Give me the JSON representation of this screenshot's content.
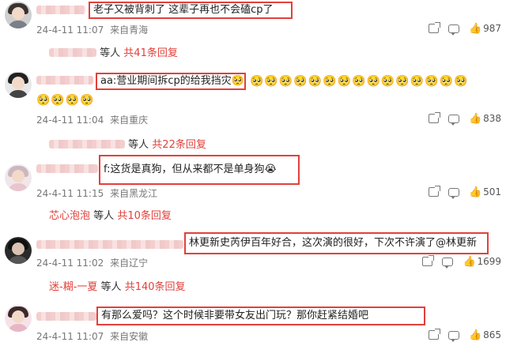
{
  "comments": [
    {
      "text": "老子又被背刺了 这辈子再也不会磕cp了",
      "date": "24-4-11 11:07",
      "location": "来自青海",
      "likes": "987",
      "reply_name": "",
      "reply_suffix": "等人",
      "reply_link": "共41条回复",
      "emojis": ""
    },
    {
      "text": "aa:营业期间拆cp的给我挡灾🥺",
      "date": "24-4-11 11:04",
      "location": "来自重庆",
      "likes": "838",
      "reply_name": "",
      "reply_suffix": "等人",
      "reply_link": "共22条回复",
      "emojis": "🥺🥺🥺🥺🥺🥺🥺🥺🥺🥺🥺🥺🥺🥺🥺",
      "emojis2": "🥺🥺🥺🥺"
    },
    {
      "text": "f:这货是真狗，但从来都不是单身狗😭",
      "date": "24-4-11 11:15",
      "location": "来自黑龙江",
      "likes": "501",
      "reply_name": "芯心泡泡",
      "reply_suffix": "等人",
      "reply_link": "共10条回复"
    },
    {
      "text": "林更新史芮伊百年好合，这次演的很好，下次不许演了@林更新",
      "date": "24-4-11 11:02",
      "location": "来自辽宁",
      "likes": "1699",
      "reply_name": "迷-糊-一夏",
      "reply_suffix": "等人",
      "reply_link": "共140条回复"
    },
    {
      "text": "有那么爱吗？这个时候非要带女友出门玩？那你赶紧结婚吧",
      "date": "24-4-11 11:07",
      "location": "来自安徽",
      "likes": "865"
    }
  ],
  "icons": {
    "share": "share-icon",
    "reply": "comment-icon",
    "like": "thumbs-up-icon"
  },
  "colors": {
    "highlight_border": "#e2403b",
    "reply_link": "#e2403b"
  }
}
